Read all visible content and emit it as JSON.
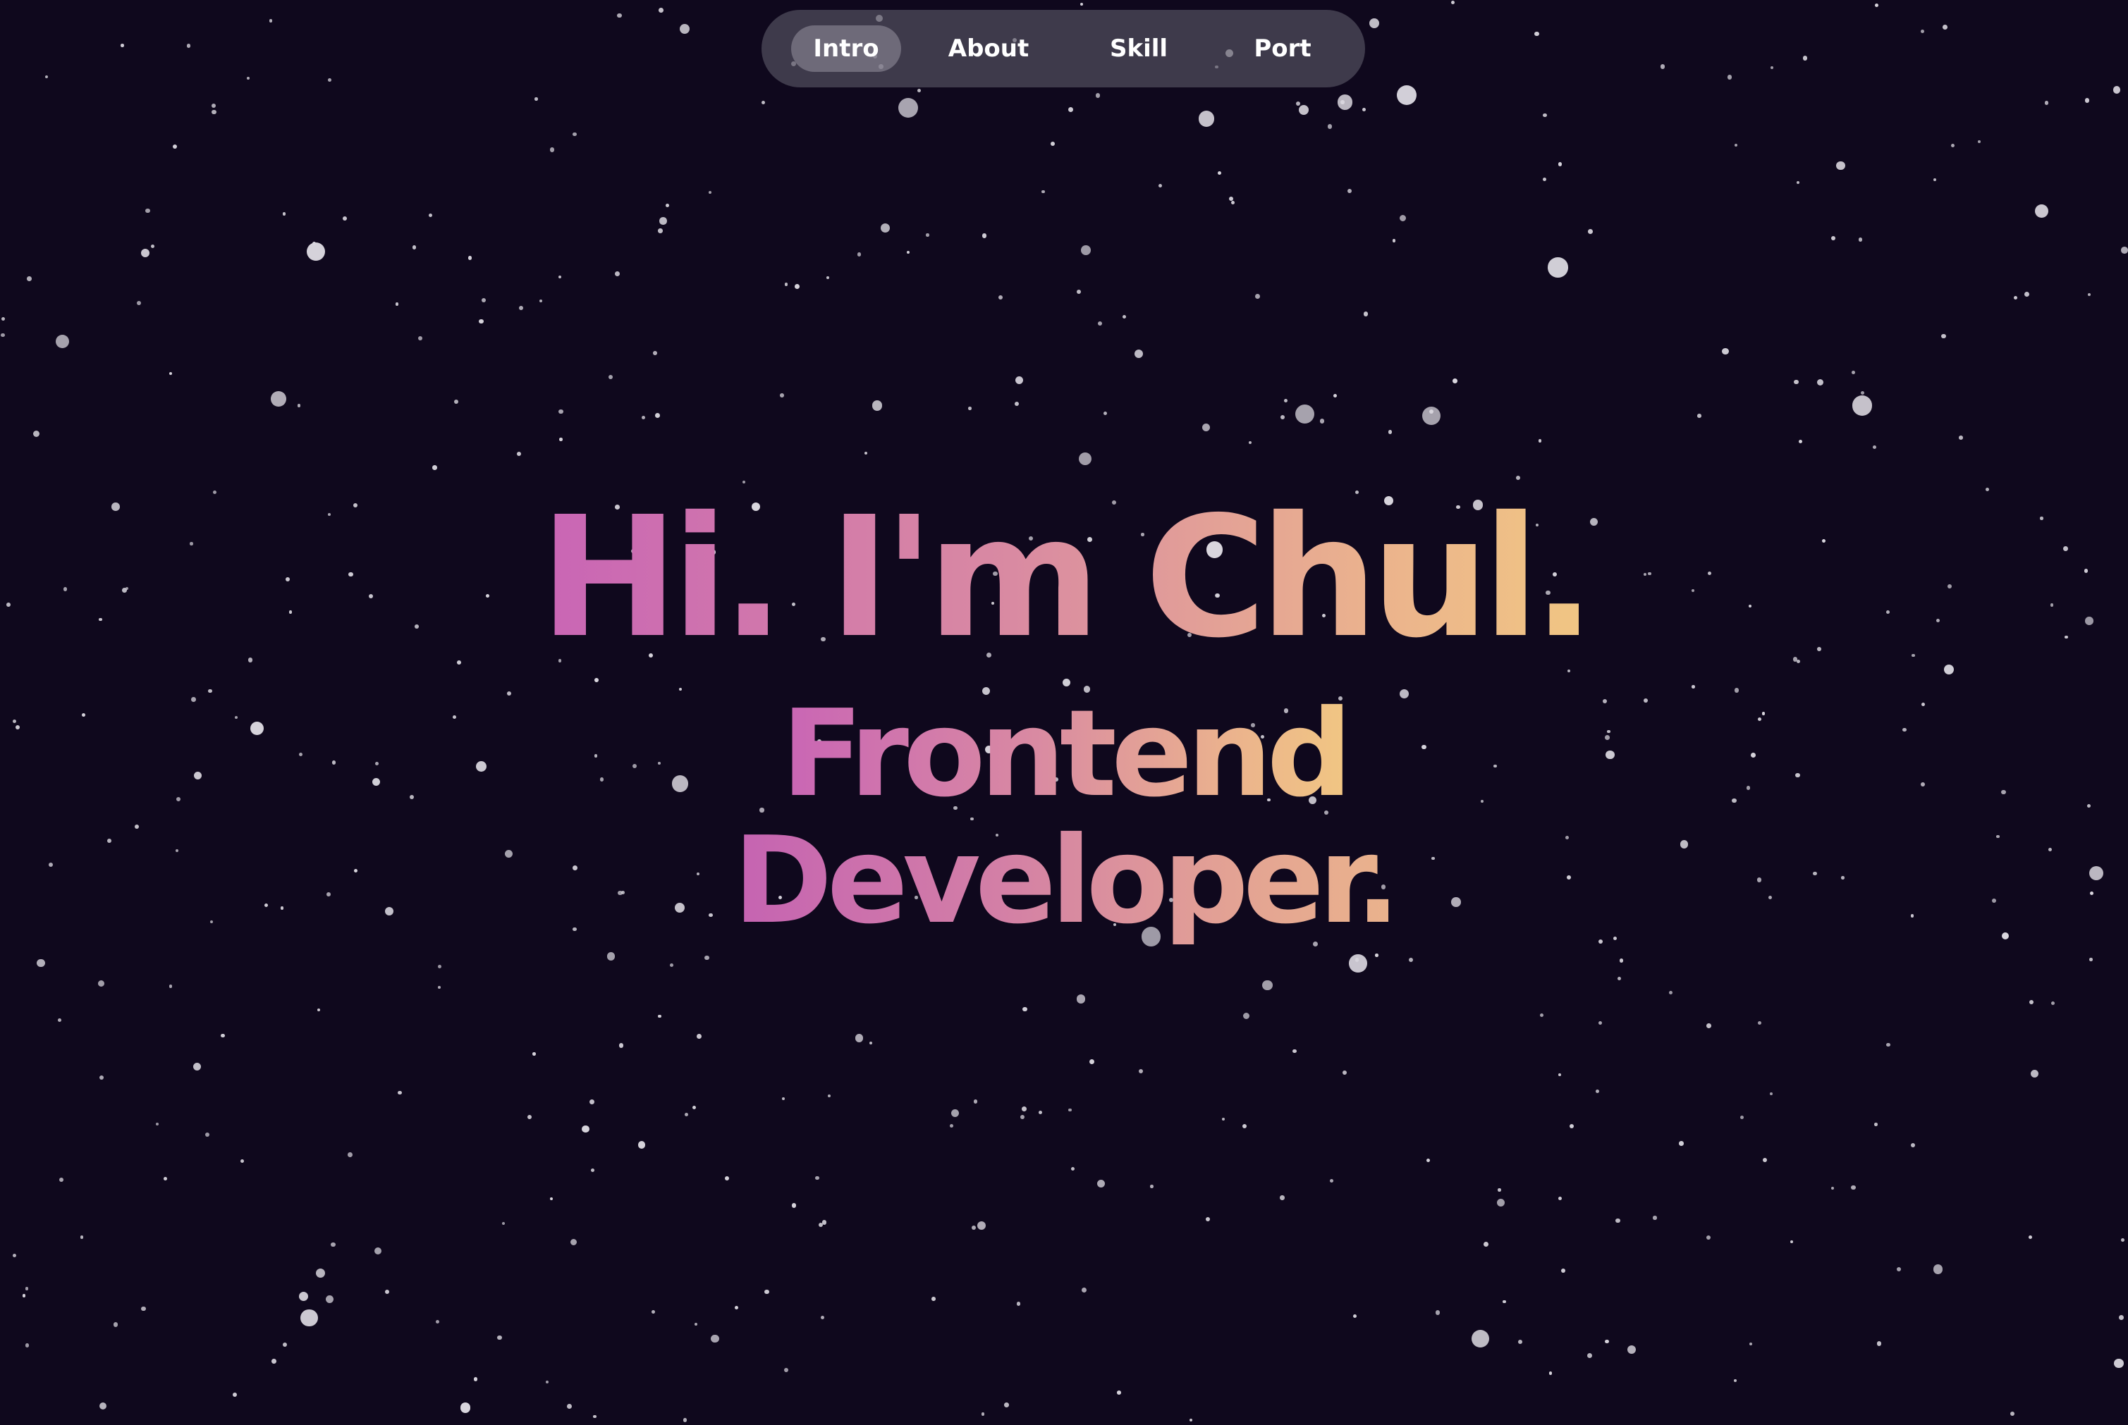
{
  "nav": {
    "items": [
      {
        "label": "Intro",
        "active": true
      },
      {
        "label": "About",
        "active": false
      },
      {
        "label": "Skill",
        "active": false
      },
      {
        "label": "Port",
        "active": false
      }
    ]
  },
  "hero": {
    "greeting": "Hi. I'm Chul.",
    "role_line1": "Frontend",
    "role_line2": "Developer."
  },
  "colors": {
    "background": "#0f081d",
    "gradient_start": "#c965b5",
    "gradient_end": "#f1c683",
    "star": "#d9d6de"
  }
}
